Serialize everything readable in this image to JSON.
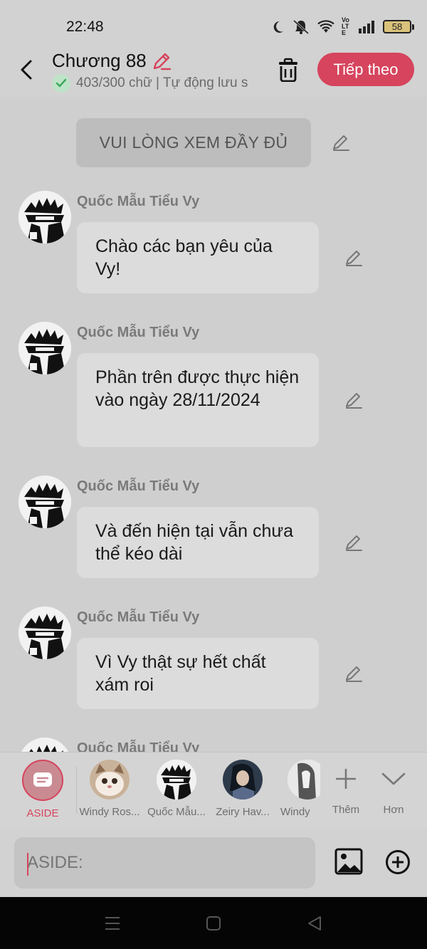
{
  "status_bar": {
    "time": "22:48",
    "battery": "58",
    "network": "VoLTE"
  },
  "header": {
    "title": "Chương 88",
    "subtitle": "403/300 chữ | Tự động lưu s",
    "next_label": "Tiếp theo"
  },
  "chat": {
    "narration": "VUI LÒNG XEM ĐẦY ĐỦ",
    "messages": [
      {
        "sender": "Quốc Mẫu Tiểu Vy",
        "text": "Chào các bạn yêu của Vy!"
      },
      {
        "sender": "Quốc Mẫu Tiểu Vy",
        "text": "Phần trên được thực hiện vào ngày 28/11/2024"
      },
      {
        "sender": "Quốc Mẫu Tiểu Vy",
        "text": "Và đến hiện tại vẫn chưa thể kéo dài"
      },
      {
        "sender": "Quốc Mẫu Tiểu Vy",
        "text": "Vì Vy thật sự hết chất xám roi"
      },
      {
        "sender": "Quốc Mẫu Tiểu Vy",
        "text": ""
      }
    ]
  },
  "characters": {
    "aside_label": "ASIDE",
    "items": [
      {
        "name": "Windy Ros..."
      },
      {
        "name": "Quốc Mẫu..."
      },
      {
        "name": "Zeiry Hav..."
      },
      {
        "name": "Windy"
      }
    ],
    "more_label": "Thêm",
    "expand_label": "Hơn"
  },
  "input": {
    "placeholder": "ASIDE:"
  },
  "colors": {
    "accent": "#d6445d",
    "background": "#cfcfcf",
    "bubble": "#dcdcdc"
  },
  "icons": [
    "back-arrow-icon",
    "pencil-icon",
    "check-icon",
    "trash-icon",
    "image-icon",
    "plus-circle-icon",
    "plus-icon",
    "chevron-down-icon",
    "menu-icon",
    "home-square-icon",
    "back-triangle-icon"
  ]
}
